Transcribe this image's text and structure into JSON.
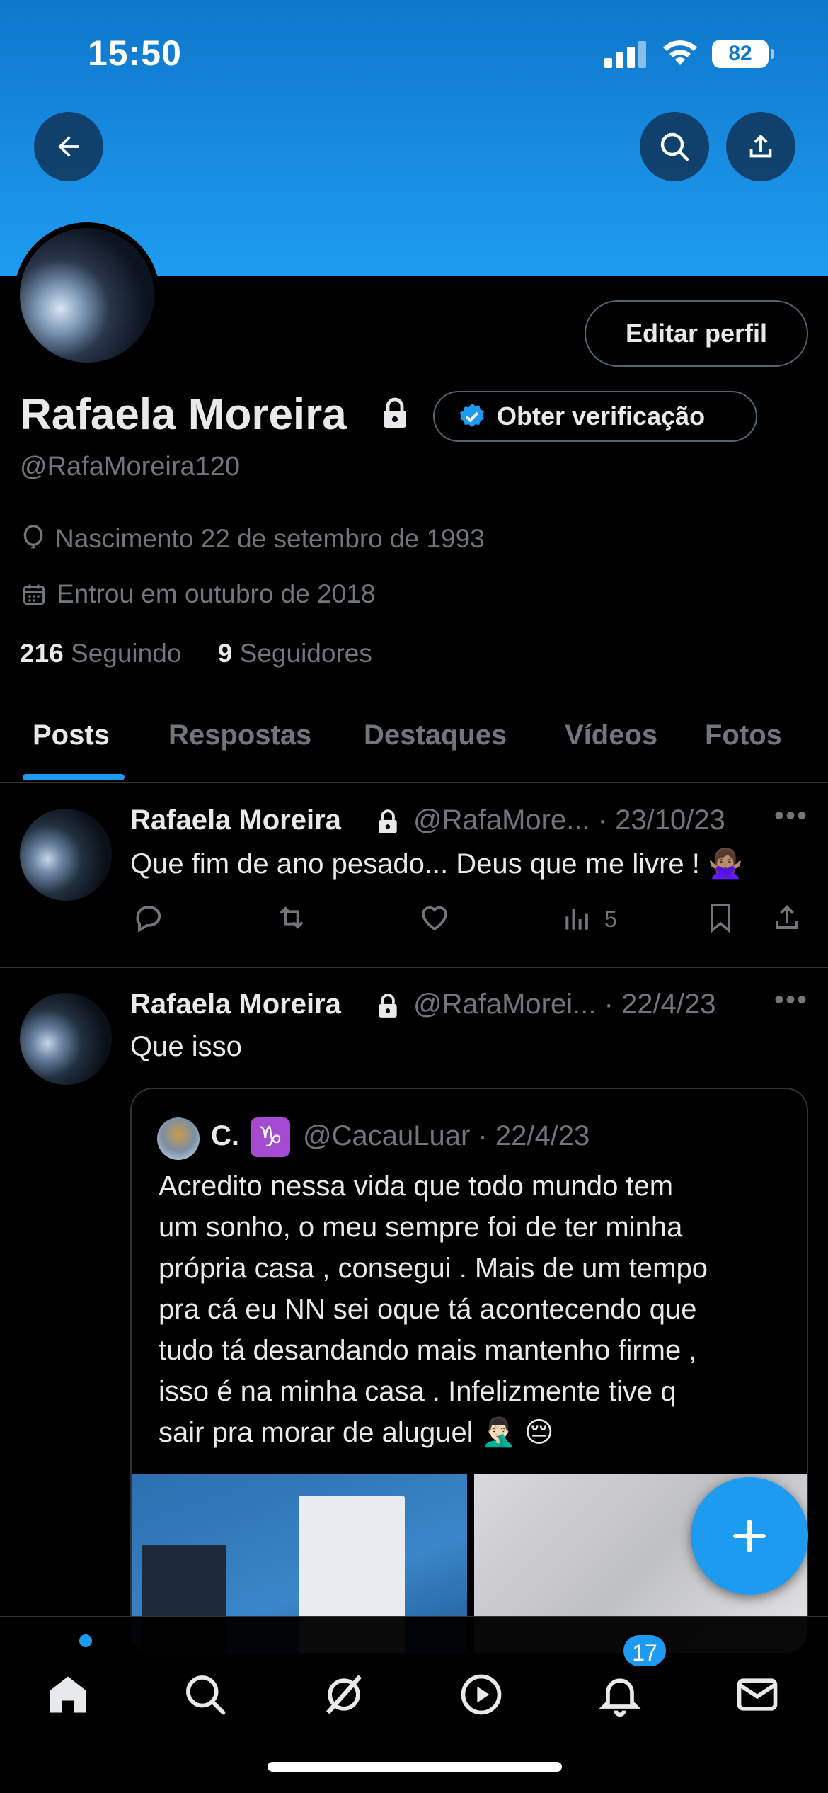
{
  "status_bar": {
    "time": "15:50",
    "battery": "82"
  },
  "header": {
    "back_icon": "arrow-left-icon",
    "search_icon": "search-icon",
    "share_icon": "share-icon"
  },
  "profile": {
    "edit_button": "Editar perfil",
    "name": "Rafaela Moreira",
    "verify_button": "Obter verificação",
    "handle": "@RafaMoreira120",
    "birth": "Nascimento 22 de setembro de 1993",
    "joined": "Entrou em outubro de 2018",
    "following_count": "216",
    "following_label": "Seguindo",
    "followers_count": "9",
    "followers_label": "Seguidores"
  },
  "tabs": [
    "Posts",
    "Respostas",
    "Destaques",
    "Vídeos",
    "Fotos"
  ],
  "posts": [
    {
      "name": "Rafaela Moreira",
      "handle_date": "@RafaMore... · 23/10/23",
      "text": "Que fim de ano pesado... Deus que me livre ! 🙅🏽‍♀️",
      "views": "5"
    },
    {
      "name": "Rafaela Moreira",
      "handle_date": "@RafaMorei... · 22/4/23",
      "text": "Que isso",
      "quote": {
        "name": "C.",
        "zodiac": "♑",
        "handle_date": "@CacauLuar · 22/4/23",
        "lines": [
          "Acredito nessa vida que todo mundo tem",
          "um sonho, o meu sempre foi de ter minha",
          "própria casa , consegui . Mais de um tempo",
          "pra cá eu NN sei oque tá acontecendo que",
          "tudo tá desandando mais mantenho firme ,",
          "isso é na minha casa . Infelizmente tive q",
          "sair pra morar de aluguel 🤦🏻‍♂️ 😔"
        ]
      }
    }
  ],
  "bottom_nav": {
    "notifications_badge": "17"
  }
}
